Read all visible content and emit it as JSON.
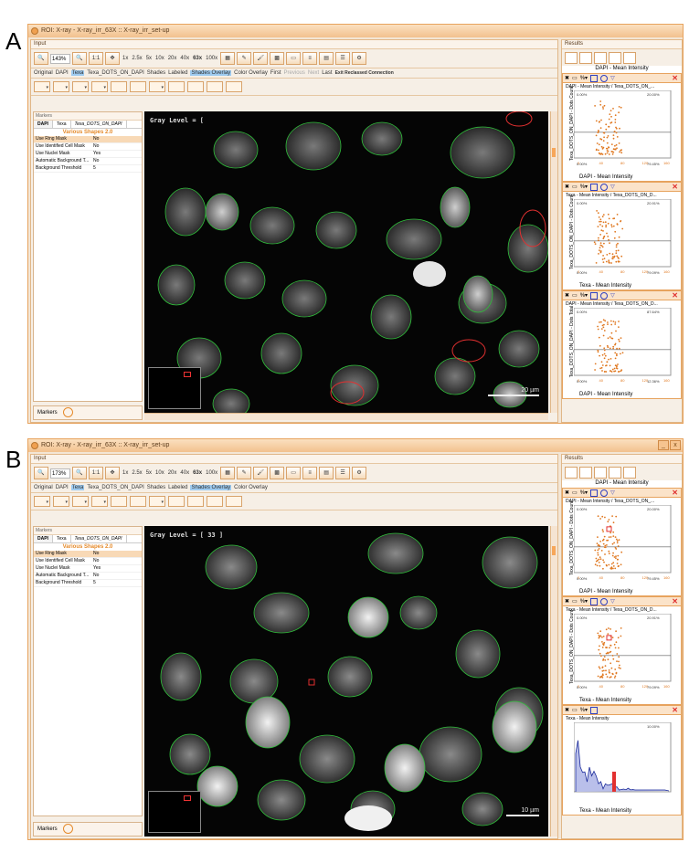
{
  "panels": [
    {
      "label": "A",
      "window_title": "ROI: X-ray - X-ray_irr_63X :: X-ray_irr_set-up",
      "input_label": "Input",
      "zoom_value": "143%",
      "zoom_levels": [
        "1x",
        "2.5x",
        "5x",
        "10x",
        "20x",
        "40x",
        "63x",
        "100x"
      ],
      "channel_tabs": [
        "Original",
        "DAPI",
        "Texa",
        "Texa_DOTS_ON_DAPI",
        "Shades",
        "Labeled",
        "Shades Overlay",
        "Color Overlay",
        "First",
        "Previous",
        "Next",
        "Last",
        "Exit Reclassed Connection"
      ],
      "markers_label": "Markers",
      "marker_tabs": [
        "DAPI",
        "Texa",
        "Texa_DOTS_ON_DAPI"
      ],
      "shape_title": "Various Shapes 2.0",
      "properties": [
        {
          "k": "Use Ring Mask",
          "v": "No"
        },
        {
          "k": "Use Identified Cell Mask",
          "v": "No"
        },
        {
          "k": "Use Nuclei Mask",
          "v": "Yes"
        },
        {
          "k": "Automatic Background T...",
          "v": "No"
        },
        {
          "k": "Background Threshold",
          "v": "5"
        }
      ],
      "markers_footer": "Markers",
      "gray_level": "Gray Level = [ ",
      "scale_bar": "20 µm",
      "results_label": "Results",
      "top_plot_xlabel": "DAPI - Mean Intensity",
      "plots": [
        {
          "title": "DAPI - Mean Intensity / Texa_DOTS_ON_...",
          "ylabel": "Texa_DOTS_ON_DAPI - Dots Count",
          "xlabel": "DAPI - Mean Intensity",
          "q_tl": "0.00%",
          "q_tr": "20.00%",
          "q_bl": "0.00%",
          "q_br": "79.45%",
          "ticks": [
            "0",
            "40",
            "80",
            "120",
            "160"
          ]
        },
        {
          "title": "Texa - Mean Intensity / Texa_DOTS_ON_D...",
          "ylabel": "Texa_DOTS_ON_DAPI - Dots Count",
          "xlabel": "Texa - Mean Intensity",
          "q_tl": "0.00%",
          "q_tr": "20.91%",
          "q_bl": "0.00%",
          "q_br": "79.09%",
          "ticks": [
            "0",
            "40",
            "80",
            "120",
            "160"
          ]
        },
        {
          "title": "DAPI - Mean Intensity / Texa_DOTS_ON_D...",
          "ylabel": "Texa_DOTS_ON_DAPI - Dots Total",
          "xlabel": "DAPI - Mean Intensity",
          "q_tl": "0.00%",
          "q_tr": "87.64%",
          "q_bl": "0.00%",
          "q_br": "12.36%",
          "ticks": [
            "0",
            "40",
            "80",
            "120",
            "160"
          ]
        }
      ]
    },
    {
      "label": "B",
      "window_title": "ROI: X-ray - X-ray_irr_63X :: X-ray_irr_set-up",
      "input_label": "Input",
      "zoom_value": "173%",
      "zoom_levels": [
        "1x",
        "2.5x",
        "5x",
        "10x",
        "20x",
        "40x",
        "63x",
        "100x"
      ],
      "channel_tabs": [
        "Original",
        "DAPI",
        "Texa",
        "Texa_DOTS_ON_DAPI",
        "Shades",
        "Labeled",
        "Shades Overlay",
        "Color Overlay"
      ],
      "markers_label": "Markers",
      "marker_tabs": [
        "DAPI",
        "Texa",
        "Texa_DOTS_ON_DAPI"
      ],
      "shape_title": "Various Shapes 2.0",
      "properties": [
        {
          "k": "Use Ring Mask",
          "v": "No"
        },
        {
          "k": "Use Identified Cell Mask",
          "v": "No"
        },
        {
          "k": "Use Nuclei Mask",
          "v": "Yes"
        },
        {
          "k": "Automatic Background T...",
          "v": "No"
        },
        {
          "k": "Background Threshold",
          "v": "5"
        }
      ],
      "markers_footer": "Markers",
      "gray_level": "Gray Level = [ 33 ]",
      "scale_bar": "10 µm",
      "results_label": "Results",
      "top_plot_xlabel": "DAPI - Mean Intensity",
      "plots": [
        {
          "title": "DAPI - Mean Intensity / Texa_DOTS_ON_...",
          "ylabel": "Texa_DOTS_ON_DAPI - Dots Count",
          "xlabel": "DAPI - Mean Intensity",
          "q_tl": "0.00%",
          "q_tr": "20.00%",
          "q_bl": "0.00%",
          "q_br": "79.45%",
          "ticks": [
            "0",
            "40",
            "80",
            "120",
            "160"
          ]
        },
        {
          "title": "Texa - Mean Intensity / Texa_DOTS_ON_D...",
          "ylabel": "Texa_DOTS_ON_DAPI - Dots Count",
          "xlabel": "Texa - Mean Intensity",
          "q_tl": "0.00%",
          "q_tr": "20.91%",
          "q_bl": "0.00%",
          "q_br": "79.09%",
          "ticks": [
            "0",
            "40",
            "80",
            "120",
            "160"
          ]
        },
        {
          "title": "Texa - Mean Intensity",
          "ylabel": "",
          "xlabel": "Texa - Mean Intensity",
          "q_tl": "",
          "q_tr": "10.00%",
          "q_bl": "",
          "q_br": "",
          "ticks": [
            "0",
            "40",
            "80"
          ]
        }
      ]
    }
  ],
  "colors": {
    "accent": "#e58a2a",
    "outline_green": "#2fbf3a",
    "outline_red": "#e23030",
    "scatter": "#e07820",
    "histogram": "#1a2a9a"
  }
}
